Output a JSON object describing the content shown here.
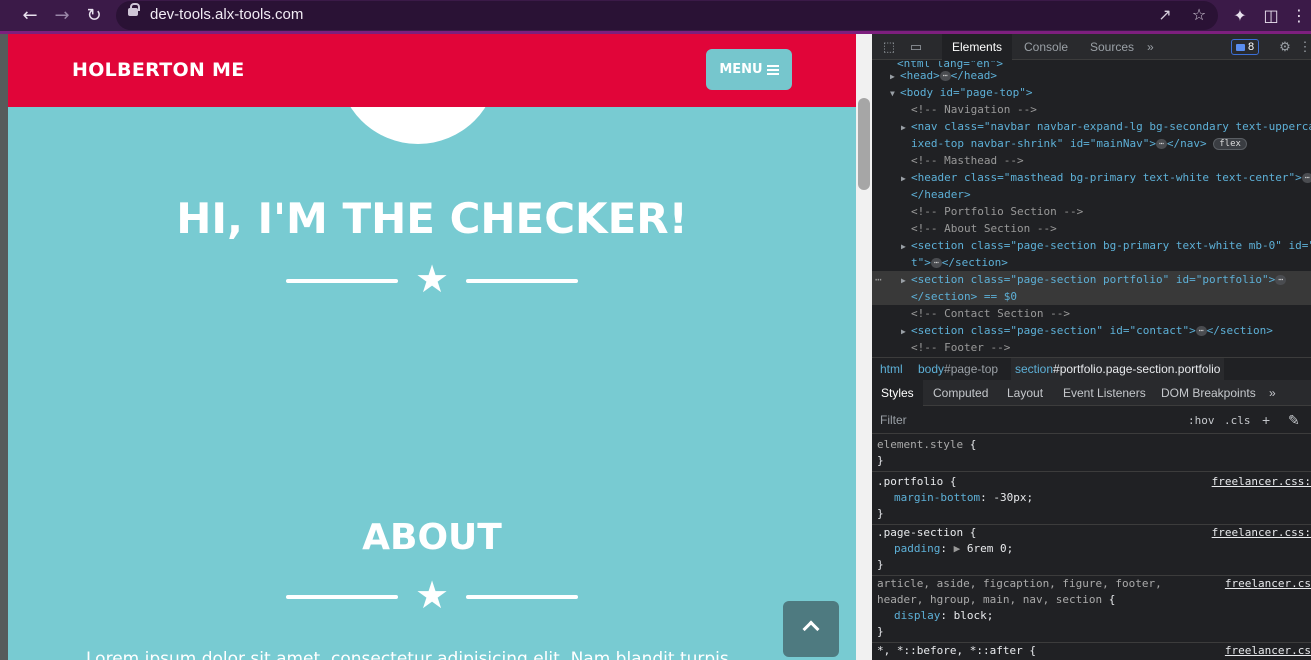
{
  "browser": {
    "url": "dev-tools.alx-tools.com"
  },
  "page": {
    "brand": "HOLBERTON ME",
    "menu_label": "MENU",
    "hero_title": "HI, I'M THE CHECKER!",
    "about_title": "ABOUT",
    "about_text": "Lorem ipsum dolor sit amet, consectetur adipisicing elit. Nam blandit turpis"
  },
  "devtools": {
    "tabs": [
      "Elements",
      "Console",
      "Sources"
    ],
    "more": "»",
    "issues_count": "8",
    "dom": [
      {
        "text": "<html lang=\"en\">"
      },
      {
        "text": "<head>",
        "close": "</head>"
      },
      {
        "text": "<body id=\"page-top\">"
      },
      {
        "text": "<!-- Navigation -->"
      },
      {
        "text": "<nav class=\"navbar navbar-expand-lg bg-secondary text-uppercase f"
      },
      {
        "text": "ixed-top navbar-shrink\" id=\"mainNav\">"
      },
      {
        "text": "<!-- Masthead -->"
      },
      {
        "text": "<header class=\"masthead bg-primary text-white text-center\">"
      },
      {
        "text": "</header>"
      },
      {
        "text": "<!-- Portfolio Section -->"
      },
      {
        "text": "<!-- About Section -->"
      },
      {
        "text": "<section class=\"page-section bg-primary text-white mb-0\" id=\""
      },
      {
        "text": "t\">"
      },
      {
        "text": "<section class=\"page-section portfolio\" id=\"portfolio\">"
      },
      {
        "text": "</section> == $0"
      },
      {
        "text": "<!-- Contact Section -->"
      },
      {
        "text": "<section class=\"page-section\" id=\"contact\">"
      },
      {
        "text": "<!-- Footer -->"
      }
    ],
    "flex_badge": "flex",
    "breadcrumbs": [
      {
        "tag": "html",
        "rest": ""
      },
      {
        "tag": "body",
        "rest": "#page-top"
      },
      {
        "tag": "section",
        "rest": "#portfolio.page-section.portfolio"
      }
    ],
    "sub_tabs": [
      "Styles",
      "Computed",
      "Layout",
      "Event Listeners",
      "DOM Breakpoints"
    ],
    "filter_placeholder": "Filter",
    "hov": ":hov",
    "cls": ".cls",
    "rules": [
      {
        "selector": "element.style",
        "props": [],
        "source": ""
      },
      {
        "selector": ".portfolio",
        "props": [
          {
            "name": "margin-bottom",
            "value": "-30px;"
          }
        ],
        "source": "freelancer.css:"
      },
      {
        "selector": ".page-section",
        "props": [
          {
            "name": "padding",
            "value": "6rem 0;"
          }
        ],
        "source": "freelancer.css:"
      },
      {
        "selector": "article, aside, figcaption, figure, footer,",
        "selector2": "header, hgroup, main, nav, section",
        "props": [
          {
            "name": "display",
            "value": "block;"
          }
        ],
        "source": "freelancer.cs"
      },
      {
        "selector": "*, *::before, *::after",
        "props": [],
        "source": "freelancer.cs"
      }
    ]
  }
}
